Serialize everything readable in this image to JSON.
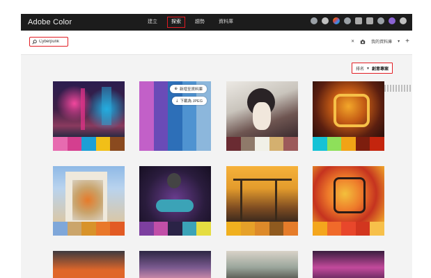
{
  "brand": "Adobe Color",
  "nav": [
    {
      "label": "建立",
      "active": false
    },
    {
      "label": "探索",
      "active": true
    },
    {
      "label": "趨勢",
      "active": false
    },
    {
      "label": "資料庫",
      "active": false
    }
  ],
  "search": {
    "value": "Cyberpunk"
  },
  "library_label": "我的資料庫",
  "sort": {
    "prefix": "排名",
    "value": "創意專案"
  },
  "overlay": {
    "add_label": "新增至資料庫",
    "download_label": "下載為 JPEG"
  },
  "colors": {
    "accent": "#e11b22"
  },
  "cards": [
    {
      "palette": [
        "#e76bb0",
        "#d43f8f",
        "#1c9fd6",
        "#f1bf18",
        "#8a4a1f"
      ]
    },
    {
      "palette": [
        "#c260c8",
        "#6a4bb7",
        "#2d6fb8",
        "#4f93d1",
        "#8cb7dc"
      ]
    },
    {
      "palette": [
        "#6a2b32",
        "#8f7a6a",
        "#f1f0e7",
        "#d4b06f",
        "#9c5a5a"
      ]
    },
    {
      "palette": [
        "#15c2d6",
        "#8ee05a",
        "#f1a316",
        "#7d1e0e",
        "#c4250e"
      ]
    },
    {
      "palette": [
        "#7fa7d9",
        "#cba56b",
        "#d8932a",
        "#e9782a",
        "#e25b24"
      ]
    },
    {
      "palette": [
        "#7d3fa0",
        "#c14fa8",
        "#2a2346",
        "#3ba3b7",
        "#e5dd41"
      ]
    },
    {
      "palette": [
        "#f0b01f",
        "#e6a129",
        "#dd8a2a",
        "#8f5a1f",
        "#e57c2a"
      ]
    },
    {
      "palette": [
        "#f4a61d",
        "#f06a2a",
        "#e8472b",
        "#d2361f",
        "#f7c04a"
      ]
    }
  ]
}
